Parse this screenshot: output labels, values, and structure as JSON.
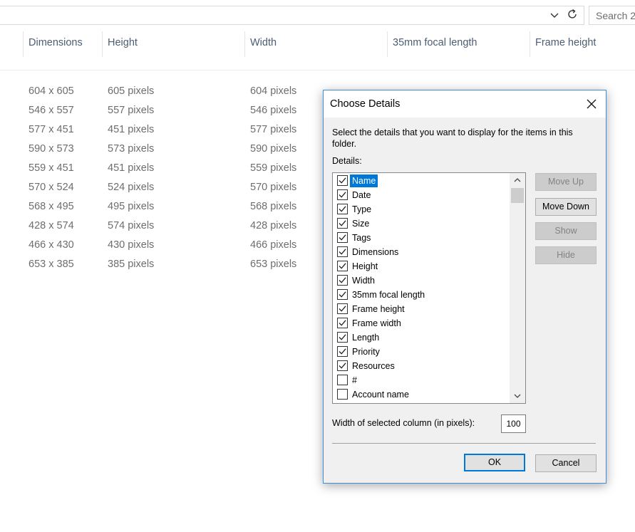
{
  "toolbar": {
    "search_placeholder": "Search 2",
    "chevron_icon": "chevron-down-icon",
    "refresh_icon": "refresh-icon"
  },
  "columns": [
    "Dimensions",
    "Height",
    "Width",
    "35mm focal length",
    "Frame height"
  ],
  "rows": [
    [
      "604 x 605",
      "605 pixels",
      "604 pixels"
    ],
    [
      "546 x 557",
      "557 pixels",
      "546 pixels"
    ],
    [
      "577 x 451",
      "451 pixels",
      "577 pixels"
    ],
    [
      "590 x 573",
      "573 pixels",
      "590 pixels"
    ],
    [
      "559 x 451",
      "451 pixels",
      "559 pixels"
    ],
    [
      "570 x 524",
      "524 pixels",
      "570 pixels"
    ],
    [
      "568 x 495",
      "495 pixels",
      "568 pixels"
    ],
    [
      "428 x 574",
      "574 pixels",
      "428 pixels"
    ],
    [
      "466 x 430",
      "430 pixels",
      "466 pixels"
    ],
    [
      "653 x 385",
      "385 pixels",
      "653 pixels"
    ]
  ],
  "dialog": {
    "title": "Choose Details",
    "description": "Select the details that you want to display for the items in this folder.",
    "details_label": "Details:",
    "items": [
      {
        "label": "Name",
        "checked": true,
        "selected": true
      },
      {
        "label": "Date",
        "checked": true
      },
      {
        "label": "Type",
        "checked": true
      },
      {
        "label": "Size",
        "checked": true
      },
      {
        "label": "Tags",
        "checked": true
      },
      {
        "label": "Dimensions",
        "checked": true
      },
      {
        "label": "Height",
        "checked": true
      },
      {
        "label": "Width",
        "checked": true
      },
      {
        "label": "35mm focal length",
        "checked": true
      },
      {
        "label": "Frame height",
        "checked": true
      },
      {
        "label": "Frame width",
        "checked": true
      },
      {
        "label": "Length",
        "checked": true
      },
      {
        "label": "Priority",
        "checked": true
      },
      {
        "label": "Resources",
        "checked": true
      },
      {
        "label": "#",
        "checked": false
      },
      {
        "label": "Account name",
        "checked": false
      }
    ],
    "buttons": {
      "move_up": "Move Up",
      "move_down": "Move Down",
      "show": "Show",
      "hide": "Hide",
      "ok": "OK",
      "cancel": "Cancel"
    },
    "width_label": "Width of selected column (in pixels):",
    "width_value": "100",
    "accent_color": "#0078d7",
    "border_color": "#3c8fd6"
  }
}
